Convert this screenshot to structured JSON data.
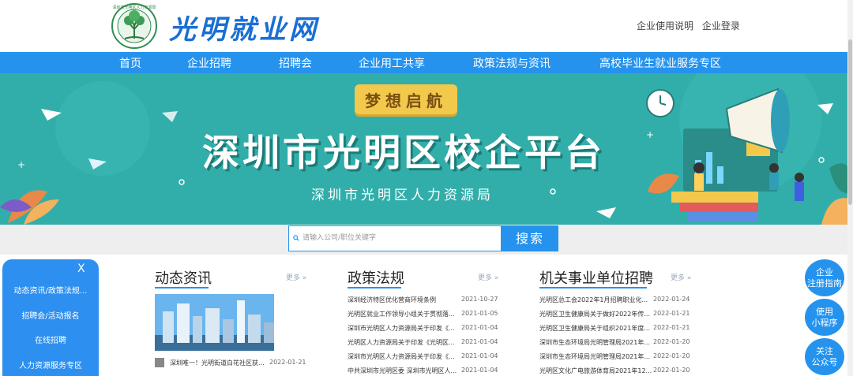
{
  "header": {
    "logo_text": "光明就业网",
    "emblem_ring_text": "深圳市光明区人力资源局",
    "links": [
      "企业使用说明",
      "企业登录"
    ]
  },
  "nav": {
    "items": [
      "首页",
      "企业招聘",
      "招聘会",
      "企业用工共享",
      "政策法规与资讯",
      "高校毕业生就业服务专区"
    ]
  },
  "banner": {
    "tag": "梦想启航",
    "title": "深圳市光明区校企平台",
    "subtitle": "深圳市光明区人力资源局",
    "slide_count": 2,
    "active_slide": 2
  },
  "search": {
    "placeholder": "请输入公司/职位关键字",
    "button": "搜索"
  },
  "left_menu": {
    "close": "X",
    "items": [
      "动态资讯/政策法规...",
      "招聘会/活动报名",
      "在线招聘",
      "人力资源服务专区"
    ]
  },
  "sections": {
    "news": {
      "title": "动态资讯",
      "more": "更多 »",
      "featured_title": "深圳唯一！光明街道白花社区获...",
      "featured_date": "2022-01-21"
    },
    "policy": {
      "title": "政策法规",
      "more": "更多 »",
      "rows": [
        {
          "title": "深圳经济特区优化营商环境条例",
          "date": "2021-10-27"
        },
        {
          "title": "光明区就业工作领导小组关于贯彻落...",
          "date": "2021-01-05"
        },
        {
          "title": "深圳市光明区人力资源局关于印发《...",
          "date": "2021-01-04"
        },
        {
          "title": "光明区人力资源局关于印发《光明区...",
          "date": "2021-01-04"
        },
        {
          "title": "深圳市光明区人力资源局关于印发《...",
          "date": "2021-01-04"
        },
        {
          "title": "中共深圳市光明区委 深圳市光明区人...",
          "date": "2021-01-04"
        }
      ]
    },
    "jobs": {
      "title": "机关事业单位招聘",
      "more": "更多 »",
      "rows": [
        {
          "title": "光明区总工会2022年1月招聘职业化...",
          "date": "2022-01-24"
        },
        {
          "title": "光明区卫生健康局关于做好2022年传...",
          "date": "2022-01-21"
        },
        {
          "title": "光明区卫生健康局关于组织2021年度...",
          "date": "2022-01-21"
        },
        {
          "title": "深圳市生态环境局光明管理局2021年...",
          "date": "2022-01-20"
        },
        {
          "title": "深圳市生态环境局光明管理局2021年...",
          "date": "2022-01-20"
        },
        {
          "title": "光明区文化广电旅游体育局2021年12...",
          "date": "2022-01-20"
        }
      ]
    }
  },
  "right_float": {
    "items": [
      "企业注册指南",
      "使用小程序",
      "关注公众号"
    ]
  },
  "colors": {
    "primary": "#2593ee",
    "banner_bg": "#32aeaa",
    "tag_bg": "#f2c94c",
    "logo_text": "#1a6fd4"
  }
}
